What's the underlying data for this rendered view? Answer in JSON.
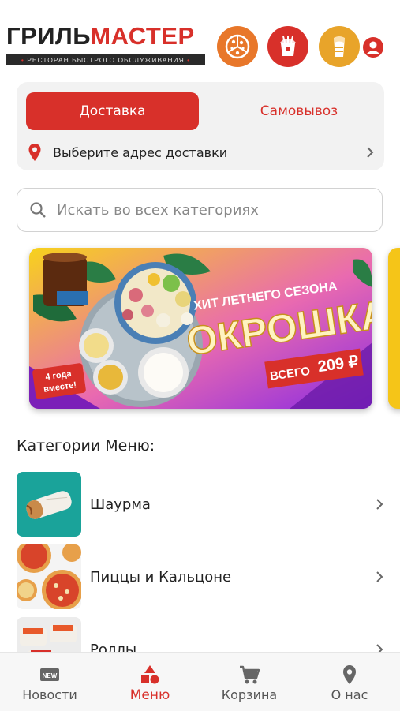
{
  "header": {
    "logo_part1": "ГРИЛЬ",
    "logo_part2": "МАСТЕР",
    "logo_tagline": "РЕСТОРАН БЫСТРОГО ОБСЛУЖИВАНИЯ",
    "shortcut_icons": [
      "pizza-icon",
      "noodle-box-icon",
      "shawarma-icon"
    ],
    "accent_color": "#d8302a"
  },
  "delivery": {
    "tab_delivery": "Доставка",
    "tab_pickup": "Самовывоз",
    "address_prompt": "Выберите адрес доставки"
  },
  "search": {
    "placeholder": "Искать во всех категориях"
  },
  "banner": {
    "headline": "ХИТ ЛЕТНЕГО СЕЗОНА",
    "product": "ОКРОШКА",
    "price_prefix": "ВСЕГО",
    "price": "209 ₽",
    "badge_line1": "4 года",
    "badge_line2": "вместе!"
  },
  "categories": {
    "title": "Категории Меню:",
    "items": [
      {
        "label": "Шаурма"
      },
      {
        "label": "Пиццы и Кальцоне"
      },
      {
        "label": "Роллы"
      }
    ]
  },
  "tabbar": {
    "items": [
      {
        "label": "Новости",
        "badge": "NEW"
      },
      {
        "label": "Меню"
      },
      {
        "label": "Корзина"
      },
      {
        "label": "О нас"
      }
    ],
    "active_index": 1
  }
}
